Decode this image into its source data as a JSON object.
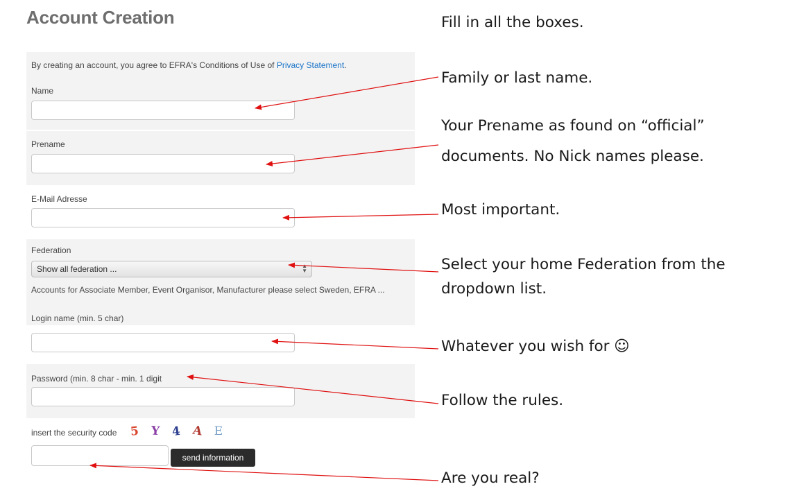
{
  "form": {
    "title": "Account Creation",
    "agreement": {
      "text": "By creating an account, you agree to EFRA's Conditions of Use of ",
      "link": "Privacy Statement",
      "end": "."
    },
    "fields": {
      "name": {
        "label": "Name",
        "value": ""
      },
      "prename": {
        "label": "Prename",
        "value": ""
      },
      "email": {
        "label": "E-Mail Adresse",
        "value": ""
      },
      "federation": {
        "label": "Federation",
        "selected": "Show all federation ...",
        "note": "Accounts for Associate Member, Event Organisor, Manufacturer please select Sweden, EFRA ..."
      },
      "login": {
        "label": "Login name (min. 5 char)",
        "value": ""
      },
      "password": {
        "label": "Password (min. 8 char - min. 1 digit",
        "value": ""
      }
    },
    "captcha": {
      "label": "insert the security code",
      "chars": [
        "5",
        "Y",
        "4",
        "A",
        "E"
      ],
      "colors": [
        "#d9452f",
        "#8a3fa6",
        "#2d3f8f",
        "#b0392f",
        "#7aa0c8"
      ],
      "value": ""
    },
    "send_button": "send information"
  },
  "annotations": {
    "fill_all": "Fill in all the boxes.",
    "name": "Family or last name.",
    "prename_1": "Your Prename as found on “official”",
    "prename_2": "documents. No Nick names please.",
    "email": "Most important.",
    "federation_1": "Select your home Federation from the",
    "federation_2": "dropdown list.",
    "login": "Whatever you wish for ☺",
    "password": "Follow the rules.",
    "captcha": "Are you real?"
  },
  "colors": {
    "arrow": "#e01010",
    "link": "#1a73c8",
    "button": "#2b2b2b"
  }
}
